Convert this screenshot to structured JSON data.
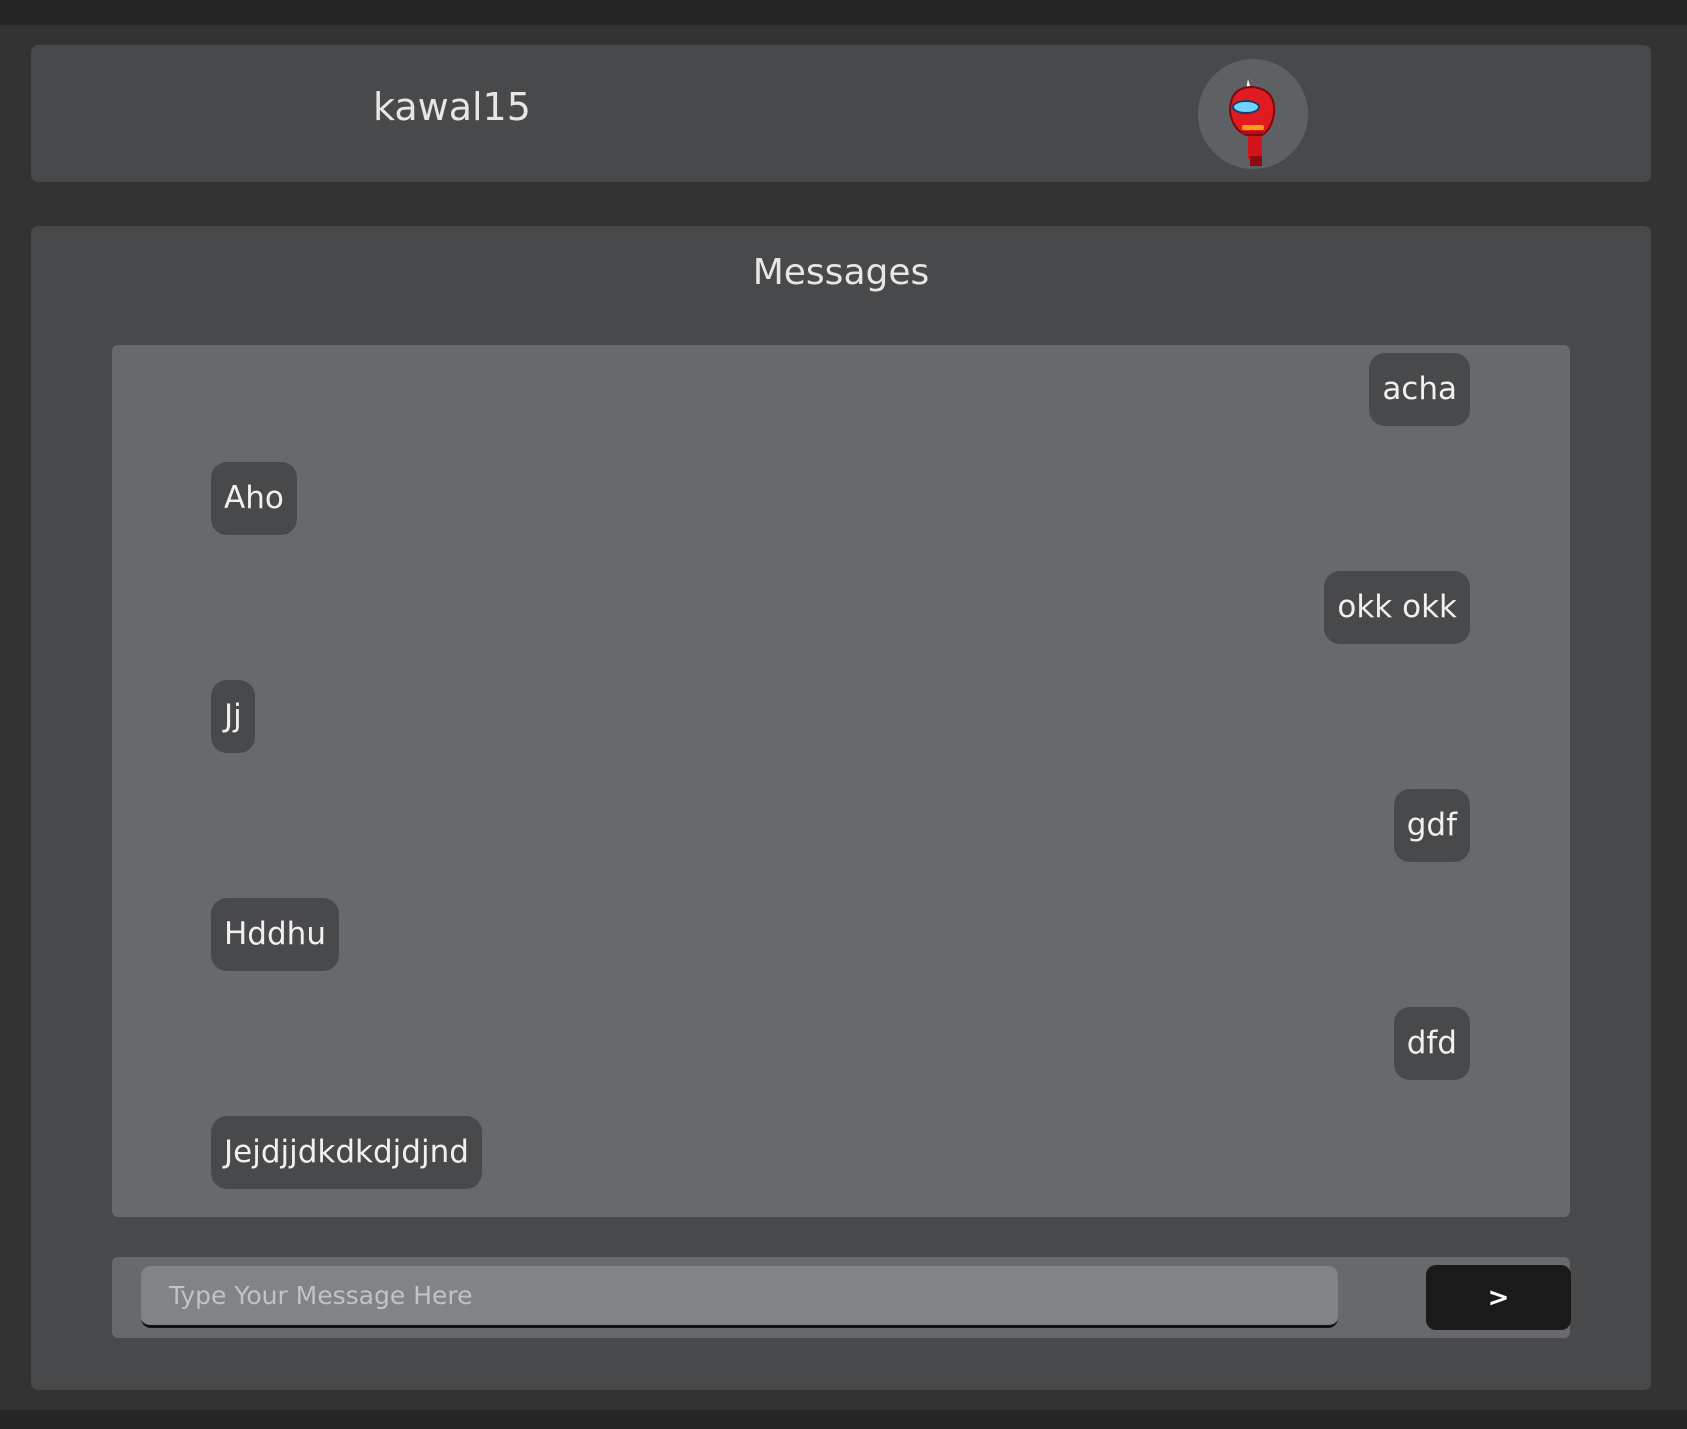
{
  "header": {
    "username": "kawal15",
    "avatar_icon": "red-robot-avatar-icon"
  },
  "main": {
    "title": "Messages",
    "messages": [
      {
        "text": "acha",
        "side": "right"
      },
      {
        "text": "Aho",
        "side": "left"
      },
      {
        "text": "okk okk",
        "side": "right"
      },
      {
        "text": "Jj",
        "side": "left"
      },
      {
        "text": "gdf",
        "side": "right"
      },
      {
        "text": "Hddhu",
        "side": "left"
      },
      {
        "text": "dfd",
        "side": "right"
      },
      {
        "text": "Jejdjjdkdkdjdjnd",
        "side": "left"
      }
    ]
  },
  "composer": {
    "placeholder": "Type Your Message Here",
    "value": "",
    "send_label": ">"
  }
}
